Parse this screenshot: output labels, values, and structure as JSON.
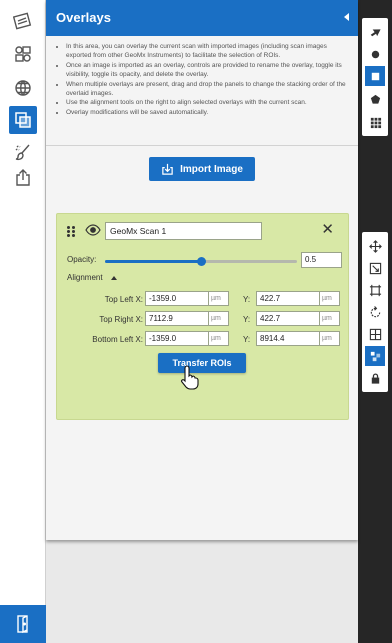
{
  "panel": {
    "title": "Overlays",
    "info_items": [
      "In this area, you can overlay the current scan with imported images (including scan images exported from other GeoMx Instruments) to facilitate the selection of ROIs.",
      "Once an image is imported as an overlay, controls are provided to rename the overlay, toggle its visibility, toggle its opacity, and delete the overlay.",
      "When multiple overlays are present, drag and drop the panels to change the stacking order of the overlaid images.",
      "Use the alignment tools on the right to align selected overlays with the current scan.",
      "Overlay modifications will be saved automatically."
    ],
    "import_button": "Import Image"
  },
  "overlay": {
    "name": "GeoMx Scan 1",
    "opacity_label": "Opacity:",
    "opacity_value": "0.5",
    "opacity_fraction": 0.5,
    "alignment_label": "Alignment",
    "rows": [
      {
        "label": "Top Left X:",
        "x": "-1359.0",
        "x_unit": "µm",
        "y_label": "Y:",
        "y": "422.7",
        "y_unit": "µm"
      },
      {
        "label": "Top Right X:",
        "x": "7112.9",
        "x_unit": "µm",
        "y_label": "Y:",
        "y": "422.7",
        "y_unit": "µm"
      },
      {
        "label": "Bottom Left X:",
        "x": "-1359.0",
        "x_unit": "µm",
        "y_label": "Y:",
        "y": "8914.4",
        "y_unit": "µm"
      }
    ],
    "transfer_button": "Transfer ROIs"
  },
  "left_toolbar": {
    "icons": [
      "scan-icon",
      "slides-icon",
      "globe-icon",
      "overlays-icon",
      "brush-icon",
      "export-icon"
    ],
    "active": "overlays-icon",
    "exit_icon": "exit-door-icon"
  },
  "right_toolbar_top": [
    "pointer-icon",
    "circle-icon",
    "square-icon",
    "polygon-icon",
    "grid-icon"
  ],
  "right_toolbar_mid": [
    "move-icon",
    "scale-icon",
    "stretch-icon",
    "rotate-icon",
    "grid-align-icon",
    "tile-icon",
    "lock-icon"
  ],
  "colors": {
    "accent": "#1a6fc4",
    "card": "#d8e8a6",
    "panel": "#f4f4f4"
  }
}
